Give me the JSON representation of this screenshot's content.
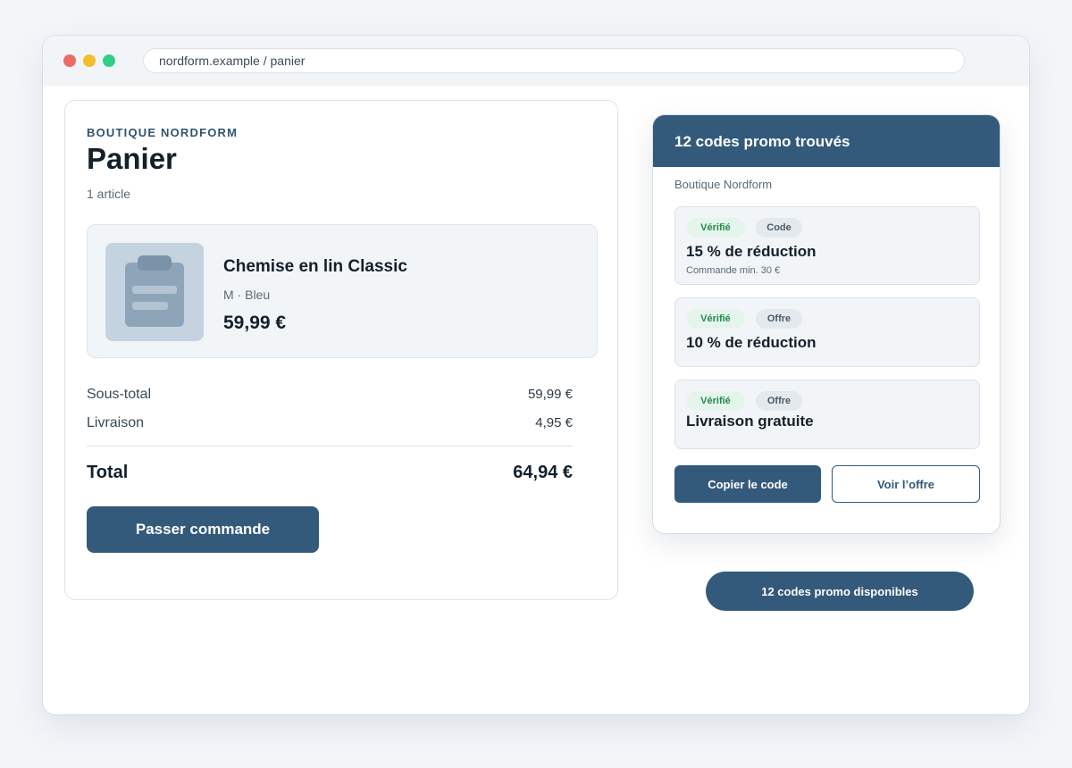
{
  "browser": {
    "address": "nordform.example / panier"
  },
  "cart": {
    "brand": "BOUTIQUE NORDFORM",
    "title": "Panier",
    "item_count": "1 article",
    "item": {
      "name": "Chemise en lin Classic",
      "variant": "M · Bleu",
      "price": "59,99 €"
    },
    "subtotal_label": "Sous-total",
    "subtotal_value": "59,99 €",
    "shipping_label": "Livraison",
    "shipping_value": "4,95 €",
    "total_label": "Total",
    "total_value": "64,94 €",
    "checkout_label": "Passer commande"
  },
  "promo": {
    "title": "12 codes promo trouvés",
    "shop": "Boutique Nordform",
    "offers": [
      {
        "badge": "Vérifié",
        "type": "Code",
        "title": "15 % de réduction",
        "note": "Commande min. 30 €"
      },
      {
        "badge": "Vérifié",
        "type": "Offre",
        "title": "10 % de réduction"
      },
      {
        "badge": "Vérifié",
        "type": "Offre",
        "title": "Livraison gratuite"
      }
    ],
    "copy_label": "Copier le code",
    "view_label": "Voir l’offre"
  },
  "floating_pill": "12 codes promo disponibles",
  "colors": {
    "primary": "#335a7a",
    "verified_text": "#1f8a4c",
    "verified_bg": "#e6f5ec",
    "dot_red": "#ee6a62",
    "dot_yellow": "#f5bd2a",
    "dot_green": "#2fcf88"
  }
}
